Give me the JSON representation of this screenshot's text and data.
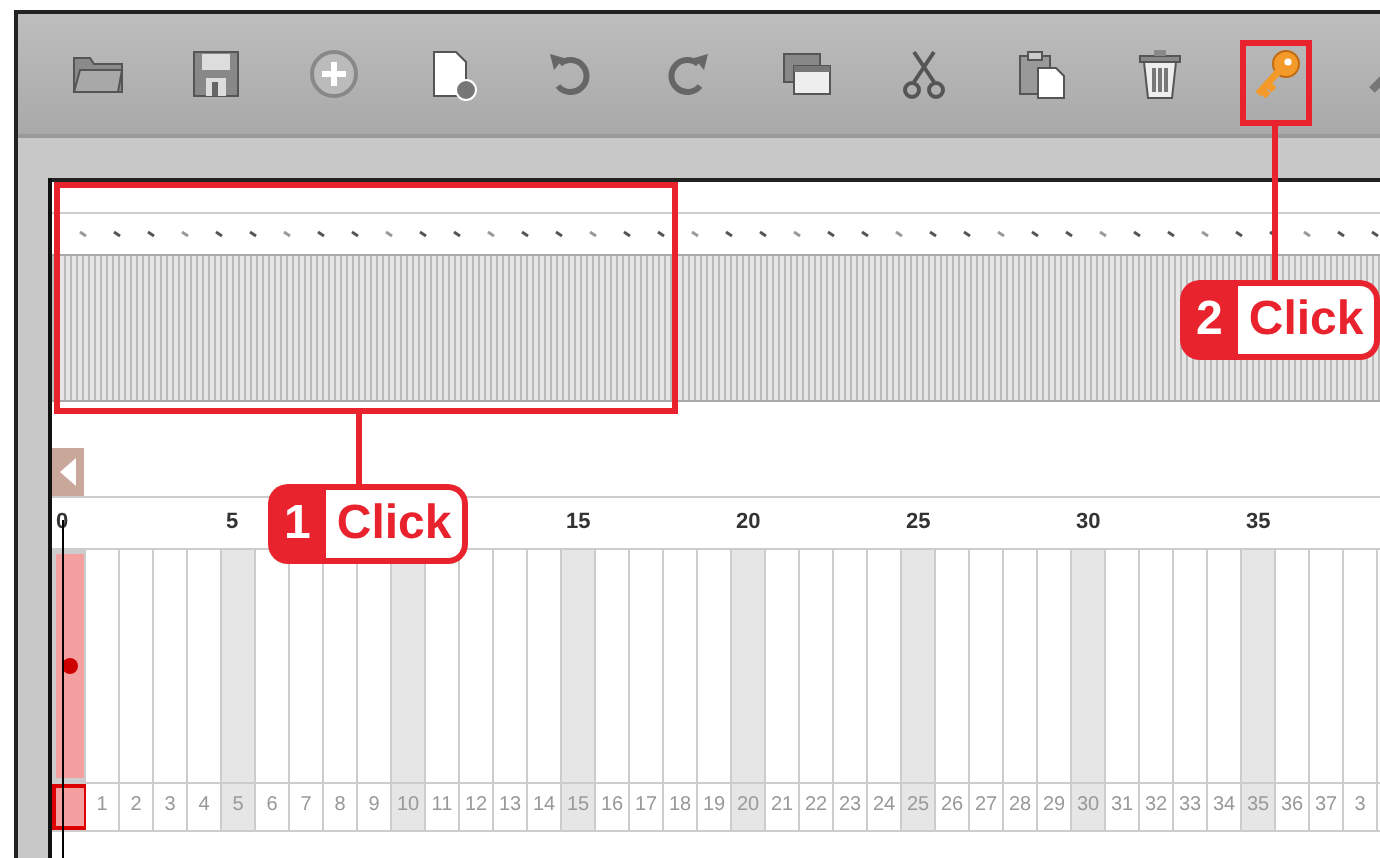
{
  "toolbar": {
    "buttons": [
      {
        "kind": "open"
      },
      {
        "kind": "save"
      },
      {
        "kind": "add"
      },
      {
        "kind": "new-page"
      },
      {
        "kind": "undo"
      },
      {
        "kind": "redo"
      },
      {
        "kind": "windows"
      },
      {
        "kind": "cut"
      },
      {
        "kind": "paste"
      },
      {
        "kind": "delete"
      },
      {
        "kind": "key"
      },
      {
        "kind": "pencil"
      }
    ]
  },
  "ruler": {
    "labels": [
      "0",
      "5",
      "15",
      "20",
      "25",
      "30",
      "35"
    ]
  },
  "frames": [
    {
      "selected": true,
      "shaded": false
    },
    {
      "label": "1",
      "selected": false,
      "shaded": false
    },
    {
      "label": "2",
      "selected": false,
      "shaded": false
    },
    {
      "label": "3",
      "selected": false,
      "shaded": false
    },
    {
      "label": "4",
      "selected": false,
      "shaded": false
    },
    {
      "label": "5",
      "selected": false,
      "shaded": true
    },
    {
      "label": "6",
      "selected": false,
      "shaded": false
    },
    {
      "label": "7",
      "selected": false,
      "shaded": false
    },
    {
      "label": "8",
      "selected": false,
      "shaded": false
    },
    {
      "label": "9",
      "selected": false,
      "shaded": false
    },
    {
      "label": "10",
      "selected": false,
      "shaded": true
    },
    {
      "label": "11",
      "selected": false,
      "shaded": false
    },
    {
      "label": "12",
      "selected": false,
      "shaded": false
    },
    {
      "label": "13",
      "selected": false,
      "shaded": false
    },
    {
      "label": "14",
      "selected": false,
      "shaded": false
    },
    {
      "label": "15",
      "selected": false,
      "shaded": true
    },
    {
      "label": "16",
      "selected": false,
      "shaded": false
    },
    {
      "label": "17",
      "selected": false,
      "shaded": false
    },
    {
      "label": "18",
      "selected": false,
      "shaded": false
    },
    {
      "label": "19",
      "selected": false,
      "shaded": false
    },
    {
      "label": "20",
      "selected": false,
      "shaded": true
    },
    {
      "label": "21",
      "selected": false,
      "shaded": false
    },
    {
      "label": "22",
      "selected": false,
      "shaded": false
    },
    {
      "label": "23",
      "selected": false,
      "shaded": false
    },
    {
      "label": "24",
      "selected": false,
      "shaded": false
    },
    {
      "label": "25",
      "selected": false,
      "shaded": true
    },
    {
      "label": "26",
      "selected": false,
      "shaded": false
    },
    {
      "label": "27",
      "selected": false,
      "shaded": false
    },
    {
      "label": "28",
      "selected": false,
      "shaded": false
    },
    {
      "label": "29",
      "selected": false,
      "shaded": false
    },
    {
      "label": "30",
      "selected": false,
      "shaded": true
    },
    {
      "label": "31",
      "selected": false,
      "shaded": false
    },
    {
      "label": "32",
      "selected": false,
      "shaded": false
    },
    {
      "label": "33",
      "selected": false,
      "shaded": false
    },
    {
      "label": "34",
      "selected": false,
      "shaded": false
    },
    {
      "label": "35",
      "selected": false,
      "shaded": true
    },
    {
      "label": "36",
      "selected": false,
      "shaded": false
    },
    {
      "label": "37",
      "selected": false,
      "shaded": false
    },
    {
      "label": "3",
      "selected": false,
      "shaded": false
    }
  ],
  "callouts": [
    {
      "number": "1",
      "text": "Click"
    },
    {
      "number": "2",
      "text": "Click"
    }
  ]
}
